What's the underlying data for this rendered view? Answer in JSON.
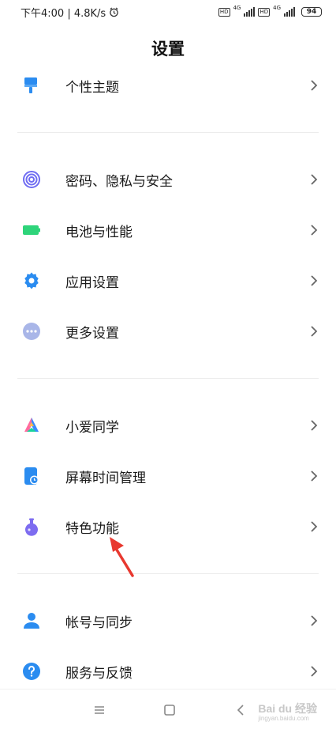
{
  "status": {
    "time_speed": "下午4:00 | 4.8K/s",
    "hd1": "HD",
    "net1": "4G",
    "hd2": "HD",
    "net2": "4G",
    "battery": "94"
  },
  "header": {
    "title": "设置"
  },
  "groups": [
    [
      {
        "label": "个性主题",
        "icon": "paint-brush-icon",
        "color": "#2b8cf0"
      }
    ],
    [
      {
        "label": "密码、隐私与安全",
        "icon": "fingerprint-icon",
        "color": "#6f6cf2"
      },
      {
        "label": "电池与性能",
        "icon": "battery-icon",
        "color": "#2ed47a"
      },
      {
        "label": "应用设置",
        "icon": "gear-icon",
        "color": "#2b8cf0"
      },
      {
        "label": "更多设置",
        "icon": "more-dots-icon",
        "color": "#a9b6e8"
      }
    ],
    [
      {
        "label": "小爱同学",
        "icon": "xiaoai-icon",
        "color": "#ff6aa0"
      },
      {
        "label": "屏幕时间管理",
        "icon": "screen-time-icon",
        "color": "#2b8cf0"
      },
      {
        "label": "特色功能",
        "icon": "flask-icon",
        "color": "#7d6cf0"
      }
    ],
    [
      {
        "label": "帐号与同步",
        "icon": "user-icon",
        "color": "#2b8cf0"
      },
      {
        "label": "服务与反馈",
        "icon": "help-icon",
        "color": "#2b8cf0"
      }
    ]
  ],
  "watermark": {
    "brand": "Bai du 经验",
    "sub": "jingyan.baidu.com"
  },
  "colors": {
    "accent": "#2b8cf0",
    "annotation_arrow": "#e8382f",
    "divider": "#ececec"
  }
}
